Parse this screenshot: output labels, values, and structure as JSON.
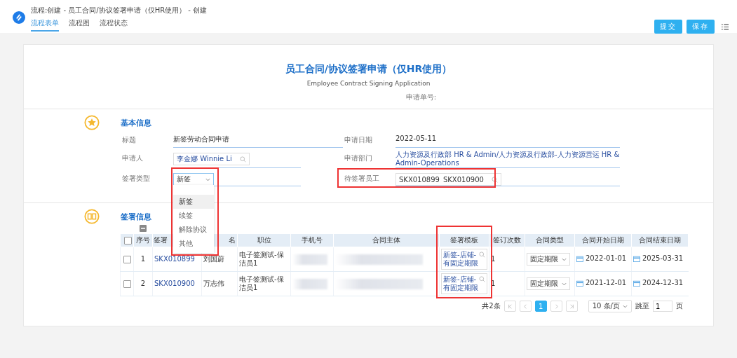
{
  "header": {
    "title": "流程:创建 - 员工合同/协议签署申请（仅HR使用） - 创建",
    "tabs": [
      {
        "label": "流程表单",
        "selected": true
      },
      {
        "label": "流程图",
        "selected": false
      },
      {
        "label": "流程状态",
        "selected": false
      }
    ],
    "buttons": [
      "提交",
      "保存"
    ]
  },
  "form": {
    "title": "员工合同/协议签署申请（仅HR使用）",
    "subtitle": "Employee Contract Signing Application",
    "number_label": "申请单号:"
  },
  "basic": {
    "heading": "基本信息",
    "title_label": "标题",
    "title_value": "新签劳动合同申请",
    "date_label": "申请日期",
    "date_value": "2022-05-11",
    "applicant_label": "申请人",
    "applicant_value": "李金娜 Winnie Li",
    "dept_label": "申请部门",
    "dept_value": "人力资源及行政部 HR & Admin/人力资源及行政部-人力资源营运 HR & Admin-Operations",
    "type_label": "签署类型",
    "type_value": "新签",
    "type_options": [
      {
        "label": "新签",
        "selected": true
      },
      {
        "label": "续签",
        "selected": false
      },
      {
        "label": "解除协议",
        "selected": false
      },
      {
        "label": "其他",
        "selected": false
      }
    ],
    "employees_label": "待签署员工",
    "employees_value": [
      "SKX010899",
      "SKX010900"
    ]
  },
  "signing": {
    "heading": "签署信息",
    "select_all_checked": false,
    "columns": [
      "序号",
      "签署",
      "名",
      "职位",
      "手机号",
      "合同主体",
      "签署模板",
      "签订次数",
      "合同类型",
      "合同开始日期",
      "合同结束日期"
    ],
    "rows": [
      {
        "checked": false,
        "index": "1",
        "code": "SKX010899",
        "name": "刘国蔚",
        "position": "电子签测试-保洁员1",
        "template": "新签-店铺-有固定期限",
        "count": "1",
        "contract_type": "固定期限",
        "start": "2022-01-01",
        "end": "2025-03-31"
      },
      {
        "checked": false,
        "index": "2",
        "code": "SKX010900",
        "name": "万志伟",
        "position": "电子签测试-保洁员1",
        "template": "新签-店铺-有固定期限",
        "count": "1",
        "contract_type": "固定期限",
        "start": "2021-12-01",
        "end": "2024-12-31"
      }
    ],
    "pagination": {
      "total": "共2条",
      "pages": [
        {
          "label": "1",
          "selected": true
        }
      ],
      "page_size": "10 条/页",
      "jump_label": "跳至",
      "jump_value": "1",
      "page_unit": "页"
    }
  }
}
